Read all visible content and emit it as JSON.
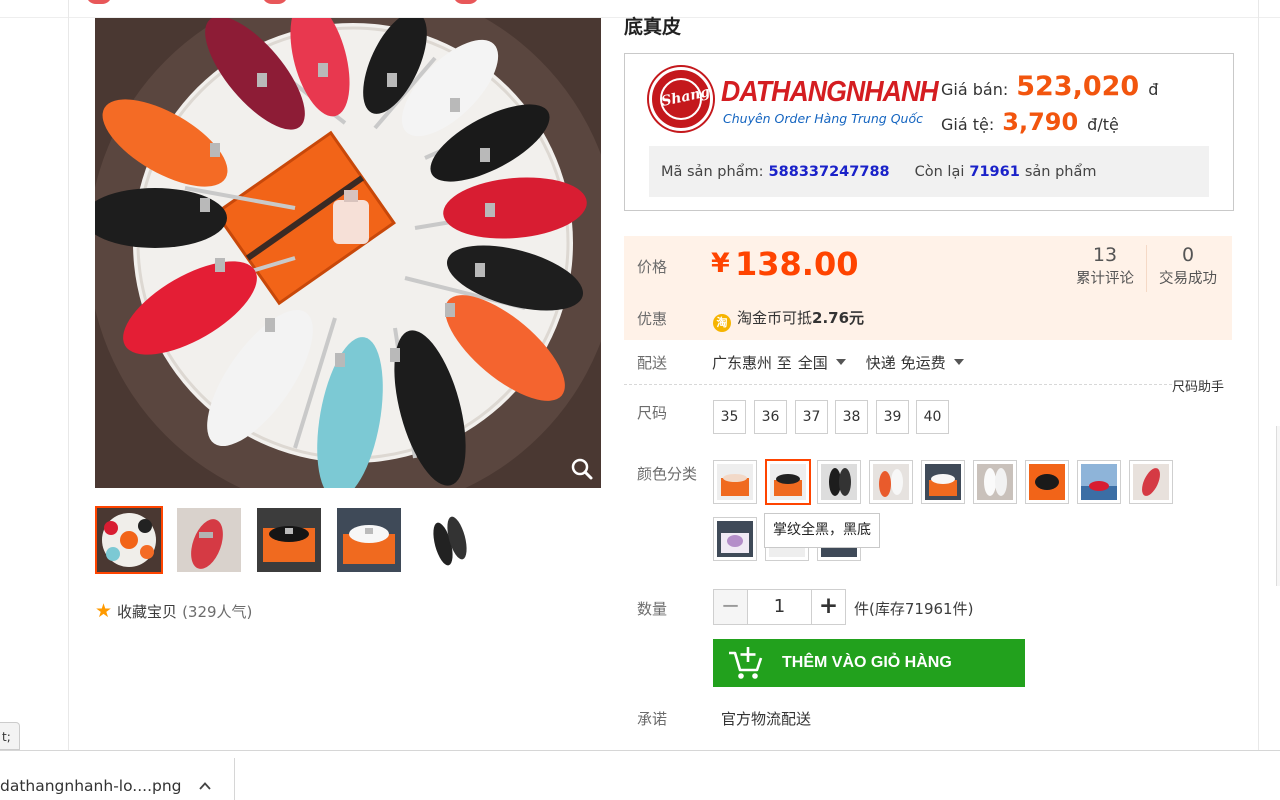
{
  "header": {
    "title_fragment": "底真皮"
  },
  "gallery": {
    "thumbnails": [
      "thumb-1",
      "thumb-2",
      "thumb-3",
      "thumb-4",
      "thumb-5"
    ],
    "active_index": 0,
    "favorite_label": "收藏宝贝",
    "favorite_count": "(329人气)"
  },
  "promo": {
    "brand_name": "DATHANGNHANH",
    "brand_tagline": "Chuyên Order Hàng Trung Quốc",
    "sale_price_label": "Giá bán:",
    "sale_price_value": "523,020",
    "sale_price_unit": "đ",
    "rate_label": "Giá tệ:",
    "rate_value": "3,790",
    "rate_unit": "đ/tệ",
    "product_code_label": "Mã sản phẩm:",
    "product_code_value": "588337247788",
    "remaining_label": "Còn lại",
    "remaining_value": "71961",
    "remaining_unit": "sản phẩm"
  },
  "price": {
    "label": "价格",
    "currency": "¥",
    "amount": "138.00",
    "reviews_count": "13",
    "reviews_label": "累计评论",
    "deals_count": "0",
    "deals_label": "交易成功",
    "promo_label": "优惠",
    "promo_coin": "淘",
    "promo_text_prefix": "淘金币可抵",
    "promo_text_value": "2.76元"
  },
  "shipping": {
    "label": "配送",
    "from": "广东惠州 至",
    "to": "全国",
    "method": "快递 免运费"
  },
  "size": {
    "label": "尺码",
    "helper": "尺码助手",
    "options": [
      "35",
      "36",
      "37",
      "38",
      "39",
      "40"
    ]
  },
  "color": {
    "label": "颜色分类",
    "active_index": 1,
    "tooltip": "掌纹全黑，黑底"
  },
  "quantity": {
    "label": "数量",
    "minus": "−",
    "value": "1",
    "plus": "+",
    "stock_text": "件(库存71961件)"
  },
  "cart_button": {
    "label": "THÊM VÀO GIỎ HÀNG"
  },
  "promise": {
    "label": "承诺",
    "value": "官方物流配送"
  },
  "side_tip": "t;",
  "download": {
    "filename": "dathangnhanh-lo....png"
  },
  "colors": {
    "accent": "#ff4400",
    "cart_green": "#22a11d",
    "brand_red": "#d41d21",
    "code_blue": "#1a22c9"
  }
}
